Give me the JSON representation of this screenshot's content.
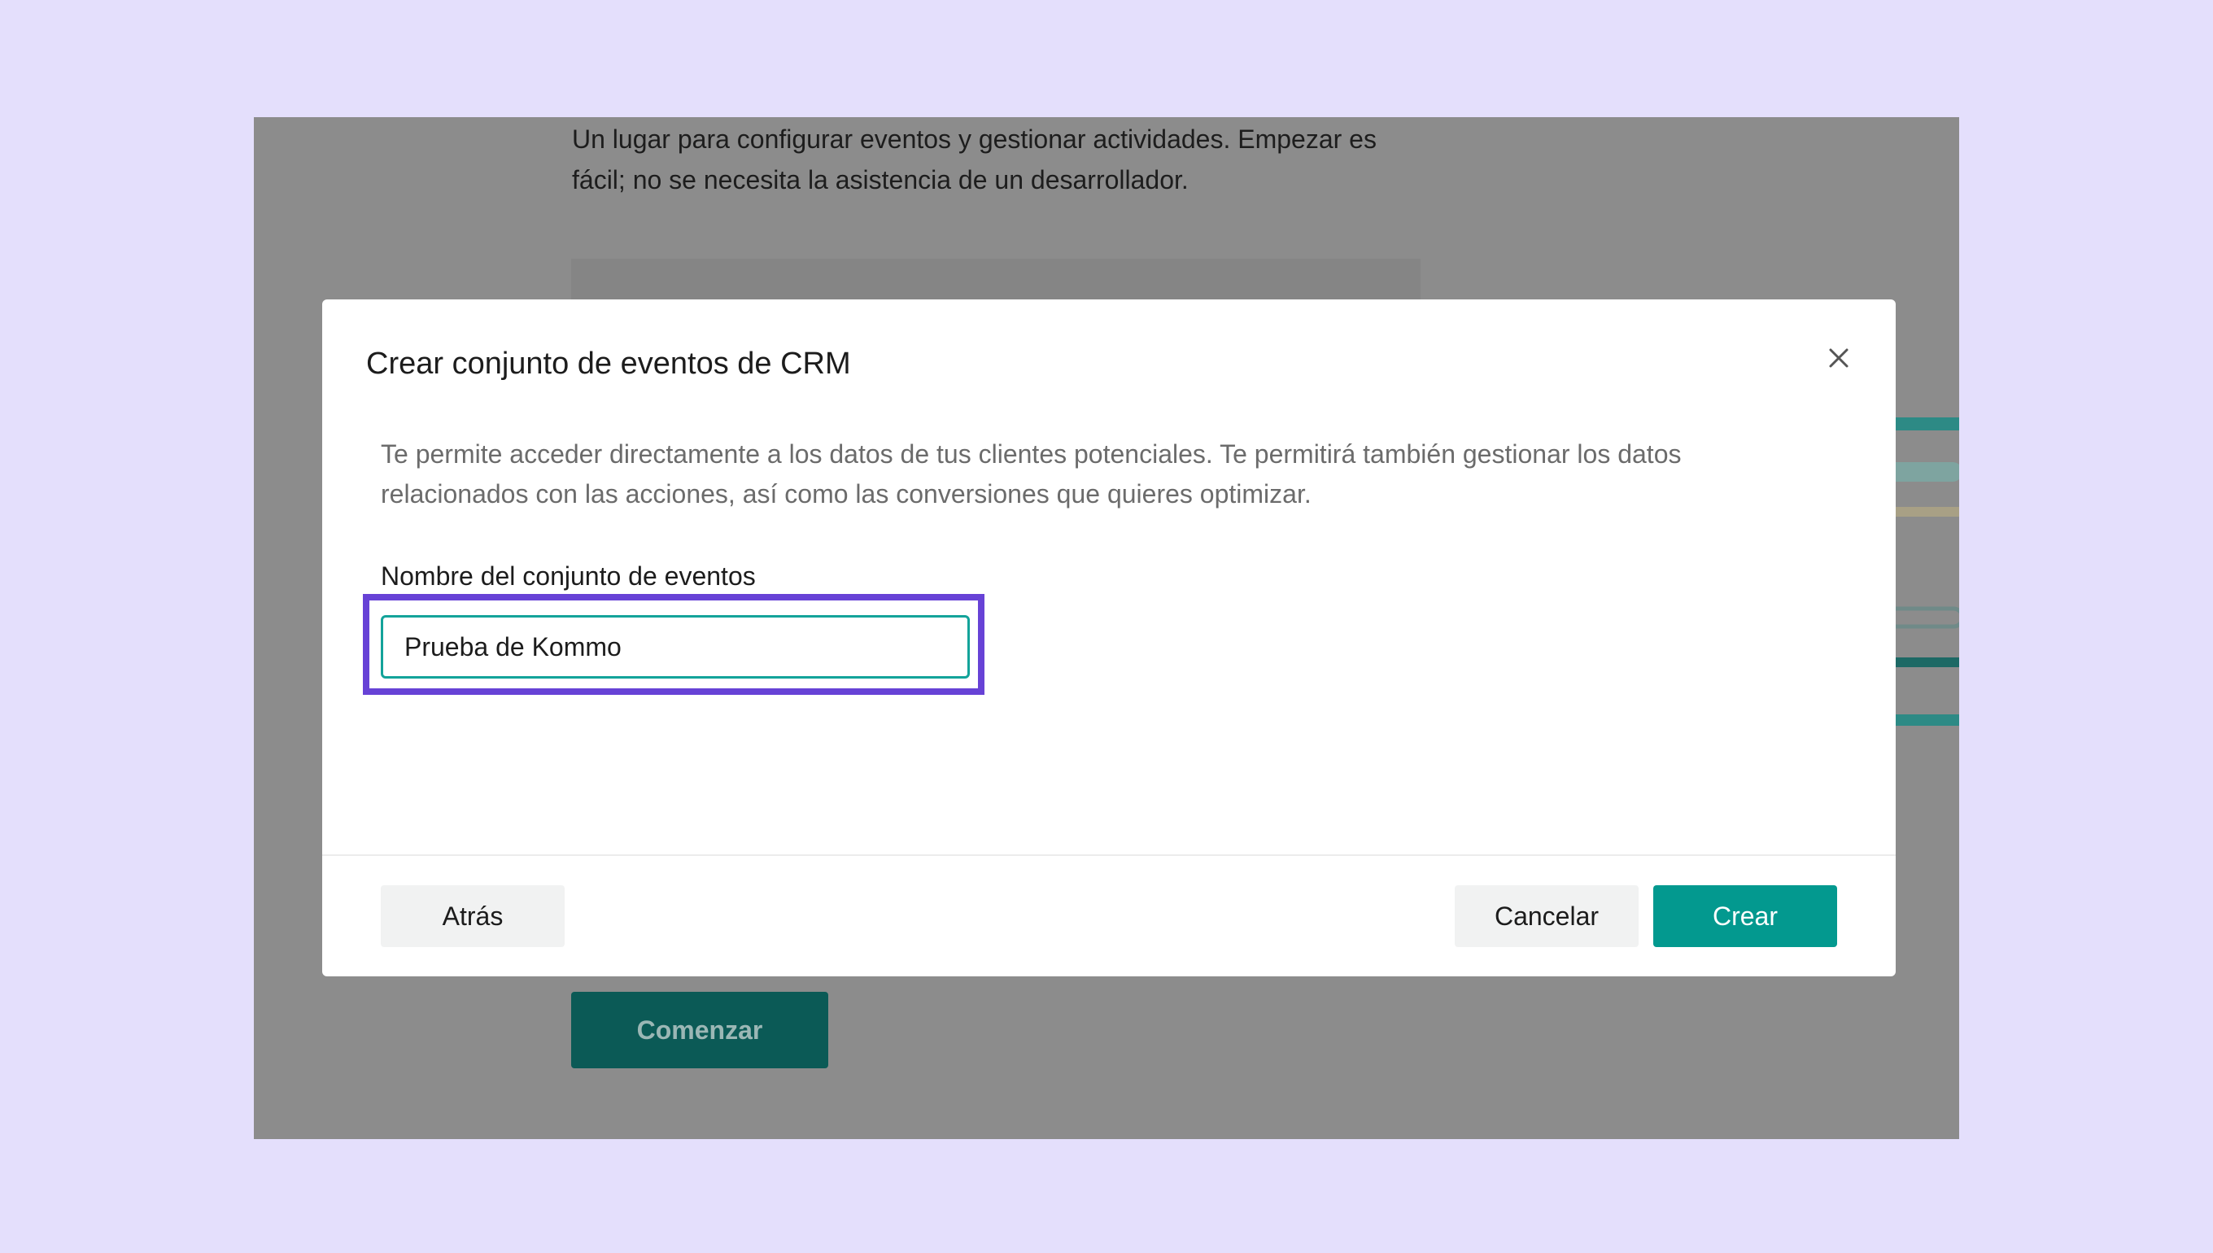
{
  "background": {
    "intro_text": "Un lugar para configurar eventos y gestionar actividades. Empezar es fácil; no se necesita la asistencia de un desarrollador.",
    "start_button_label": "Comenzar"
  },
  "modal": {
    "title": "Crear conjunto de eventos de CRM",
    "description": "Te permite acceder directamente a los datos de tus clientes potenciales. Te permitirá también gestionar los datos relacionados con las acciones, así como las conversiones que quieres optimizar.",
    "field_label": "Nombre del conjunto de eventos",
    "field_value": "Prueba de Kommo",
    "close_icon": "close-icon",
    "back_label": "Atrás",
    "cancel_label": "Cancelar",
    "create_label": "Crear"
  },
  "colors": {
    "page_background": "#e4dffc",
    "overlay": "#8c8c8c",
    "accent": "#03998f",
    "highlight": "#6742d6"
  }
}
